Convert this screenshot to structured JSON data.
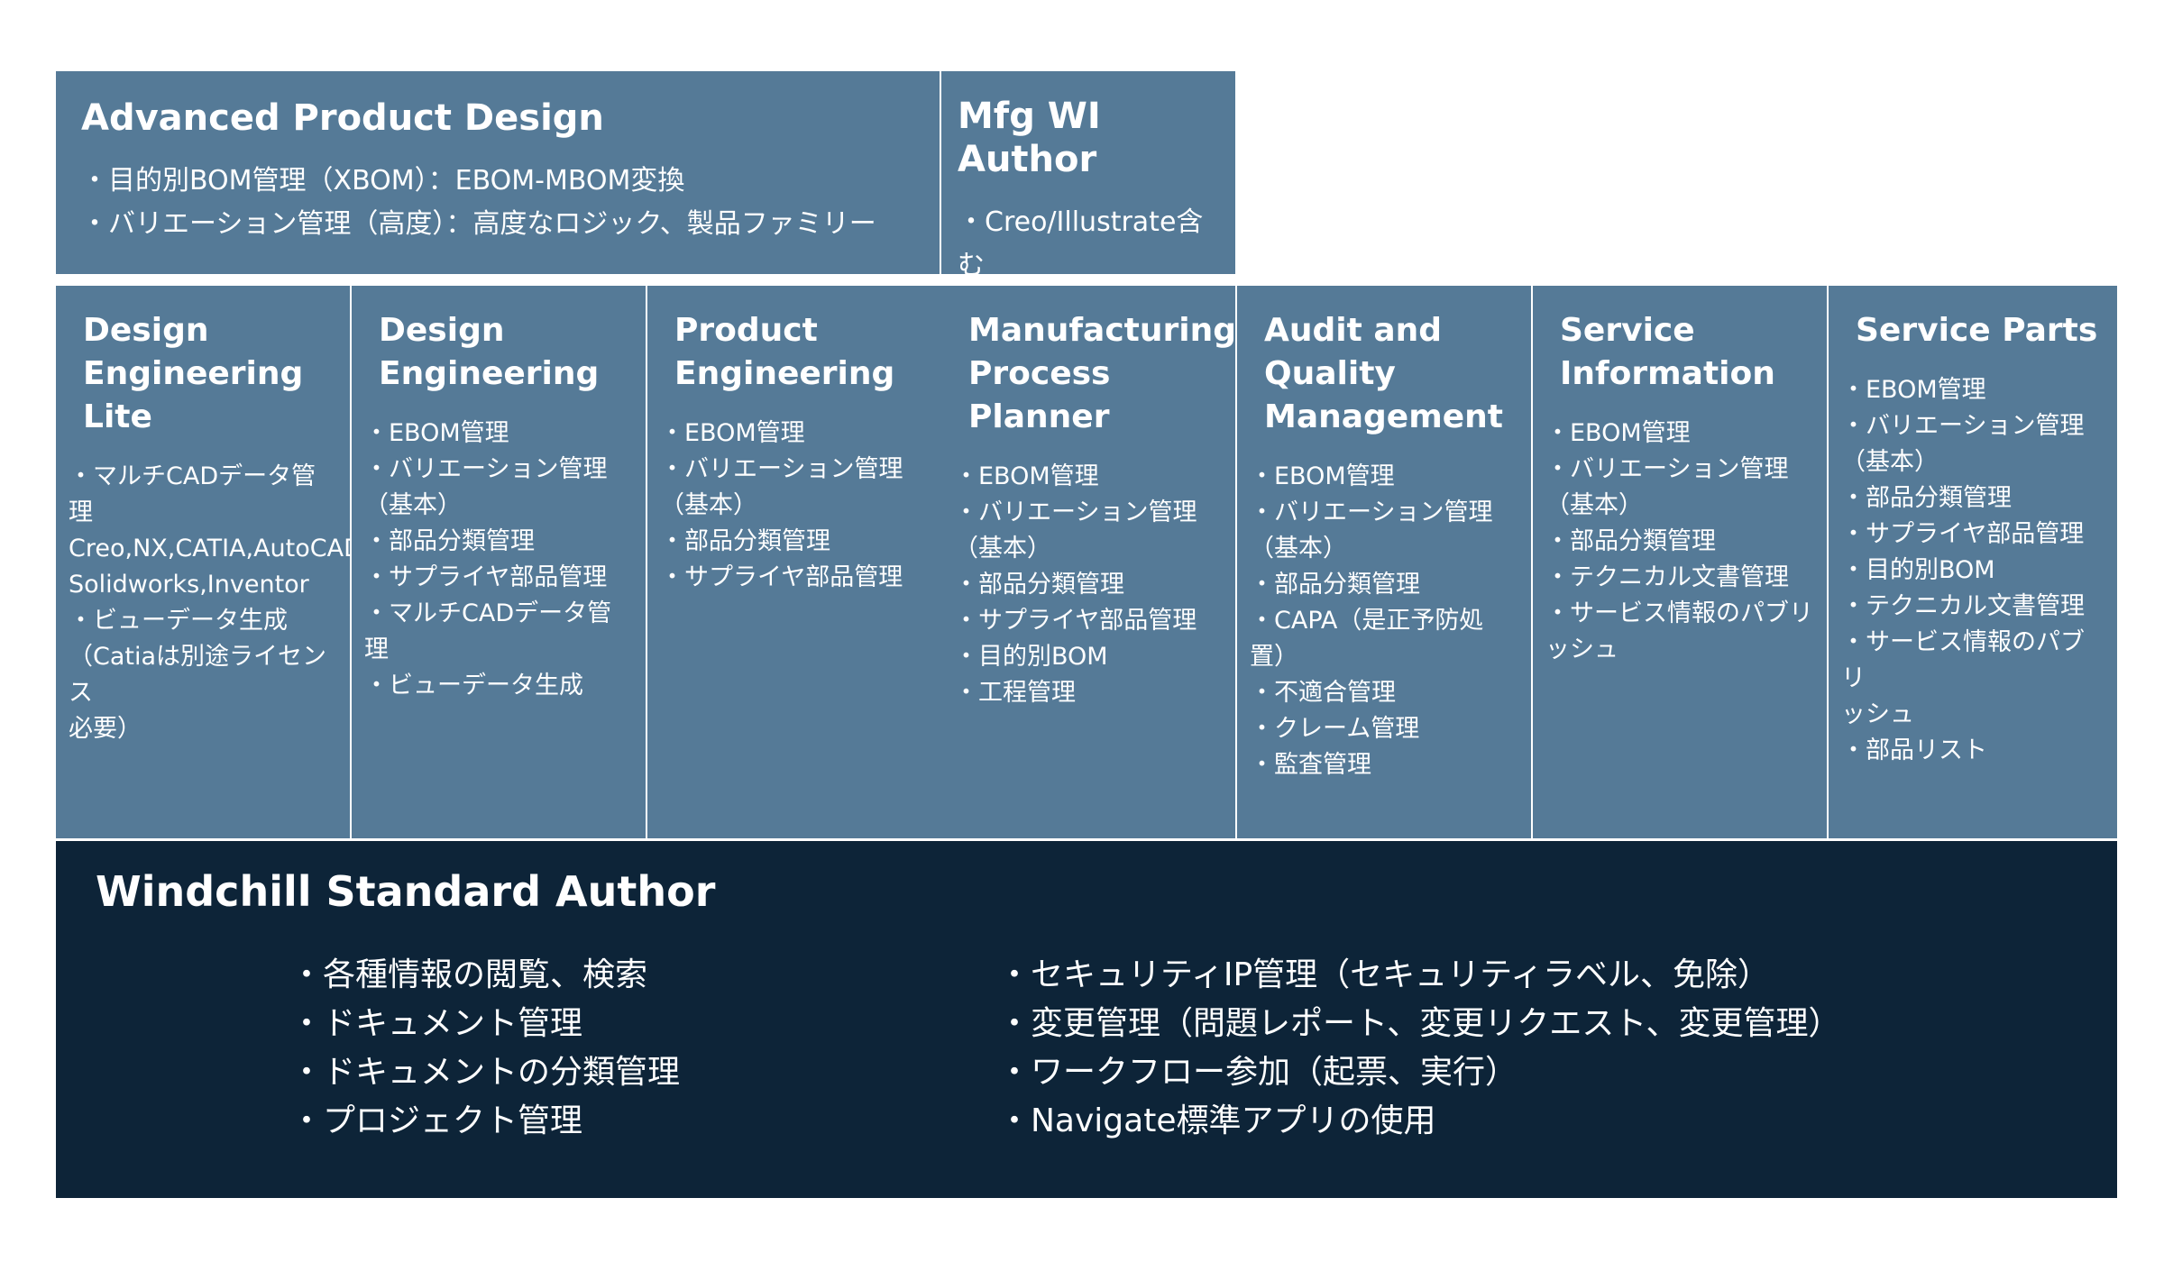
{
  "advanced_product_design": {
    "title": "Advanced Product Design",
    "items": [
      "・目的別BOM管理（XBOM）：EBOM-MBOM変換",
      "・バリエーション管理（高度）：高度なロジック、製品ファミリー"
    ]
  },
  "mfg_wi_author": {
    "title": "Mfg WI Author",
    "items": [
      "・Creo/Illustrate含む"
    ]
  },
  "roles": [
    {
      "title": "Design\nEngineering Lite",
      "items": [
        "・マルチCADデータ管理\nCreo,NX,CATIA,AutoCAD,\nSolidworks,Inventor",
        "・ビューデータ生成\n（Catiaは別途ライセンス\n必要）"
      ]
    },
    {
      "title": "Design\nEngineering",
      "items": [
        "・EBOM管理",
        "・バリエーション管理\n（基本）",
        "・部品分類管理",
        "・サプライヤ部品管理",
        "・マルチCADデータ管理",
        "・ビューデータ生成"
      ]
    },
    {
      "title": "Product\nEngineering",
      "items": [
        "・EBOM管理",
        "・バリエーション管理\n（基本）",
        "・部品分類管理",
        "・サプライヤ部品管理"
      ]
    },
    {
      "title": "Manufacturing\nProcess Planner",
      "items": [
        "・EBOM管理",
        "・バリエーション管理\n（基本）",
        "・部品分類管理",
        "・サプライヤ部品管理",
        "・目的別BOM",
        "・工程管理"
      ]
    },
    {
      "title": "Audit and Quality\nManagement",
      "items": [
        "・EBOM管理",
        "・バリエーション管理\n（基本）",
        "・部品分類管理",
        "・CAPA（是正予防処置）",
        "・不適合管理",
        "・クレーム管理",
        "・監査管理"
      ]
    },
    {
      "title": "Service\nInformation",
      "items": [
        "・EBOM管理",
        "・バリエーション管理\n（基本）",
        "・部品分類管理",
        "・テクニカル文書管理",
        "・サービス情報のパブリ\nッシュ"
      ]
    },
    {
      "title": "Service Parts",
      "items": [
        "・EBOM管理",
        "・バリエーション管理\n（基本）",
        "・部品分類管理",
        "・サプライヤ部品管理",
        "・目的別BOM",
        "・テクニカル文書管理",
        "・サービス情報のパブリ\nッシュ",
        "・部品リスト"
      ]
    }
  ],
  "standard_author": {
    "title": "Windchill Standard Author",
    "left_items": [
      "・各種情報の閲覧、検索",
      "・ドキュメント管理",
      "・ドキュメントの分類管理",
      "・プロジェクト管理"
    ],
    "right_items": [
      "・セキュリティIP管理（セキュリティラベル、免除）",
      "・変更管理（問題レポート、変更リクエスト、変更管理）",
      "・ワークフロー参加（起票、実行）",
      "・Navigate標準アプリの使用"
    ]
  },
  "colors": {
    "box_fill": "#557a97",
    "base_fill": "#0d2438",
    "text": "#ffffff"
  }
}
